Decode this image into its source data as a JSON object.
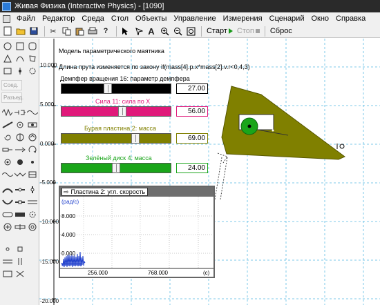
{
  "window": {
    "title": "Живая Физика (Interactive Physics) - [1090]"
  },
  "menu": {
    "items": [
      "Файл",
      "Редактор",
      "Среда",
      "Стол",
      "Объекты",
      "Управление",
      "Измерения",
      "Сценарий",
      "Окно",
      "Справка"
    ]
  },
  "toolbar": {
    "icons": [
      "new-file-icon",
      "open-folder-icon",
      "save-icon",
      "cut-icon",
      "copy-icon",
      "paste-icon",
      "print-icon",
      "help-icon",
      "arrow-pointer-icon",
      "rotate-icon",
      "text-icon",
      "zoom-in-icon",
      "zoom-out-icon",
      "zoom-fit-icon"
    ],
    "start_label": "Старт",
    "stop_label": "Стоп",
    "reset_label": "Сброс"
  },
  "palette": {
    "connect_label": "Соед.",
    "split_label": "Разъед."
  },
  "workspace": {
    "y_ticks": [
      "10.000",
      "5.000",
      "0.000",
      "-5.000",
      "-10.000",
      "-15.000",
      "-20.000"
    ],
    "model_title": "Модель параметрического маятника",
    "formula_text": "Длина прута изменяется по закону   if(mass[4].p.x*mass[2].v.r<0,4,3)",
    "meters": [
      {
        "label": "Демпфер вращения 16: параметр демпфера",
        "value": "27.00",
        "level": 0.42,
        "track_color": "#000000",
        "label_color": "#000000",
        "value_border": "#000000"
      },
      {
        "label": "Сила 11: сила по X",
        "value": "56.00",
        "level": 0.56,
        "track_color": "#e0197a",
        "label_color": "#e0197a",
        "value_border": "#e0197a"
      },
      {
        "label": "Бурая пластина 2: масса",
        "value": "69.00",
        "level": 0.69,
        "track_color": "#808000",
        "label_color": "#808000",
        "value_border": "#808000"
      },
      {
        "label": "Зелёный диск 4: масса",
        "value": "24.00",
        "level": 0.5,
        "track_color": "#1aa51a",
        "label_color": "#1aa51a",
        "value_border": "#1aa51a"
      }
    ],
    "graph": {
      "title": "Пластина 2: угл. скорость",
      "y_unit": "(рад/с)",
      "y_ticks": [
        "8.000",
        "4.000",
        "0.000"
      ],
      "x_ticks": [
        "256.000",
        "768.000"
      ],
      "x_unit": "(с)"
    }
  }
}
